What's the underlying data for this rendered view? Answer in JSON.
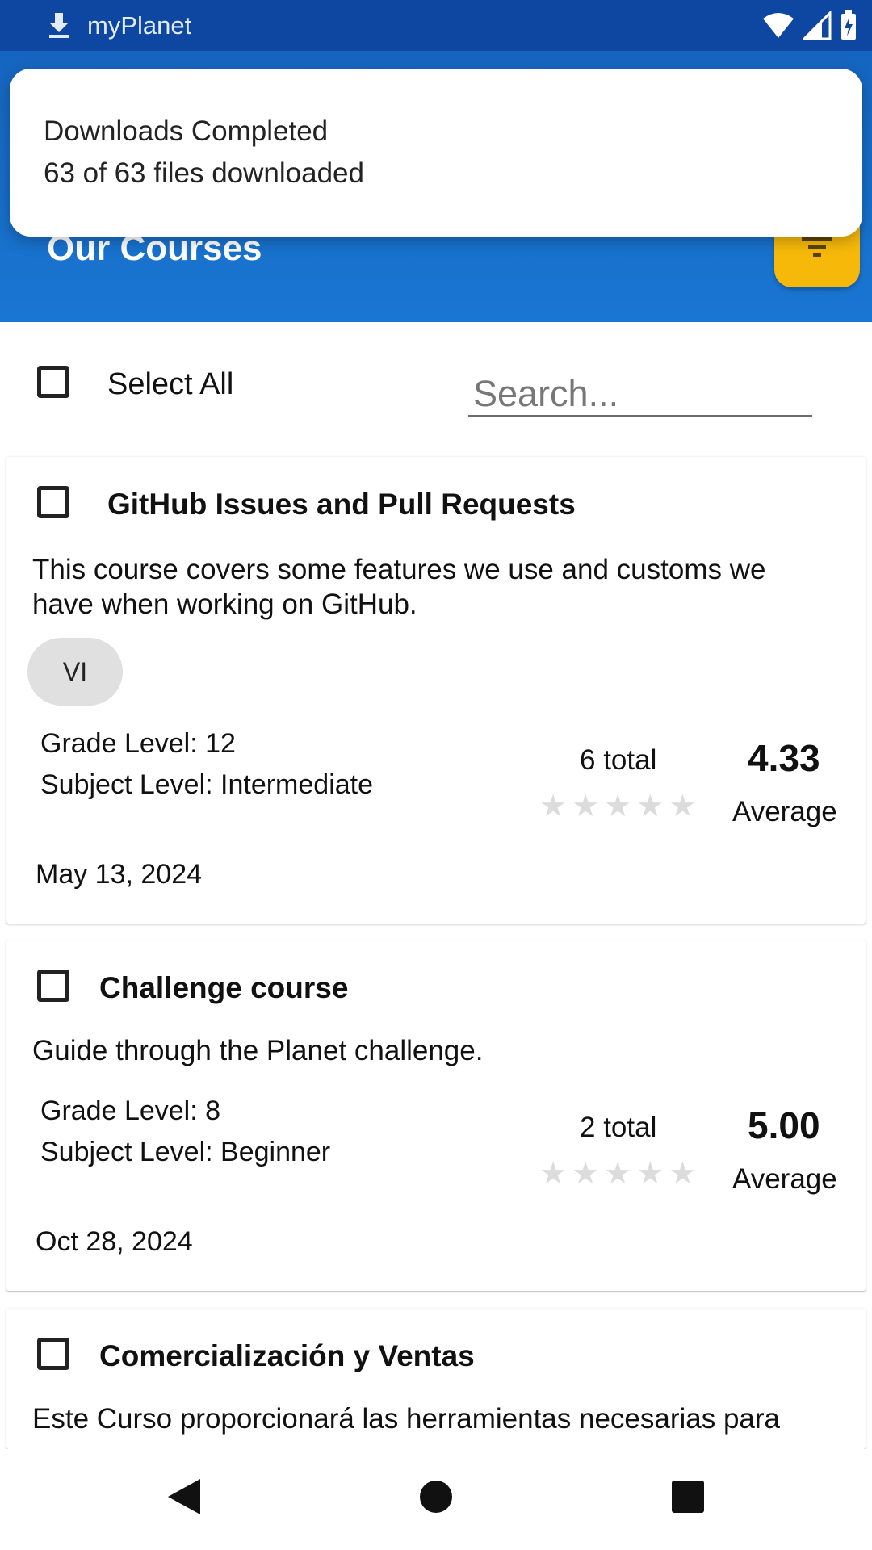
{
  "status_bar": {
    "app_name": "myPlanet"
  },
  "header": {
    "title": "Our Courses"
  },
  "toast": {
    "line1": "Downloads Completed",
    "line2": "63 of 63 files downloaded"
  },
  "controls": {
    "select_all_label": "Select All",
    "search_placeholder": "Search..."
  },
  "courses": [
    {
      "title": "GitHub Issues and Pull Requests",
      "description": "This course covers some features we use and customs we have when working on GitHub.",
      "tag": "VI",
      "grade_level": "Grade Level: 12",
      "subject_level": "Subject Level: Intermediate",
      "ratings_total": "6 total",
      "average": "4.33",
      "average_label": "Average",
      "date": "May 13, 2024"
    },
    {
      "title": "Challenge course",
      "description": "Guide through the Planet challenge.",
      "grade_level": "Grade Level: 8",
      "subject_level": "Subject Level: Beginner",
      "ratings_total": "2 total",
      "average": "5.00",
      "average_label": "Average",
      "date": "Oct 28, 2024"
    },
    {
      "title": "Comercialización y Ventas",
      "description": "Este Curso proporcionará las herramientas necesarias para"
    }
  ],
  "icons": {
    "download": "download-icon",
    "wifi": "wifi-icon",
    "signal": "signal-icon",
    "battery": "battery-charging-icon",
    "filter": "filter-icon",
    "star": "star-icon",
    "back": "back-triangle-icon",
    "home": "home-circle-icon",
    "recents": "recents-square-icon"
  },
  "colors": {
    "status_bar": "#0d47a1",
    "header": "#1976d2",
    "filter_button": "#f6b90a",
    "star_empty": "#dcdcdc"
  }
}
